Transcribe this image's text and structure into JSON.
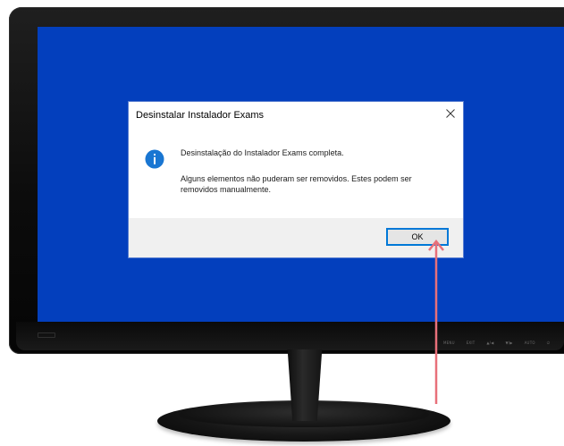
{
  "dialog": {
    "title": "Desinstalar Instalador Exams",
    "message_primary": "Desinstalação do Instalador Exams completa.",
    "message_secondary": "Alguns elementos não puderam ser removidos. Estes podem ser removidos manualmente.",
    "ok_label": "OK",
    "close_icon": "close-icon",
    "info_icon": "info-icon"
  },
  "monitor": {
    "buttons": [
      "MENU",
      "EXIT",
      "▲/◀",
      "▼/▶",
      "AUTO",
      "⏻"
    ]
  },
  "colors": {
    "desktop": "#033fbd",
    "accent": "#0078d7",
    "arrow": "#e8707a"
  }
}
